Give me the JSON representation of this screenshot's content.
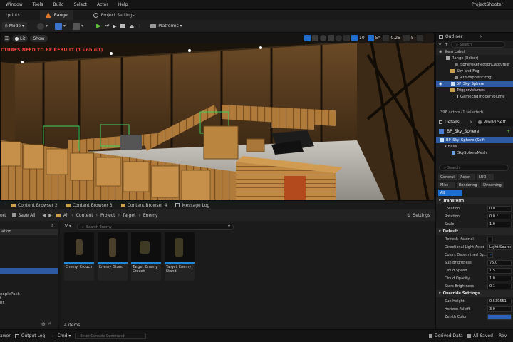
{
  "menu": {
    "items": [
      "Window",
      "Tools",
      "Build",
      "Select",
      "Actor",
      "Help"
    ],
    "project": "ProjectShooter"
  },
  "tabs": {
    "blueprints": "rprints",
    "range": "Range",
    "project_settings": "Project Settings"
  },
  "toolbar": {
    "mode": "n Mode",
    "platforms": "Platforms"
  },
  "viewport": {
    "lit": "Lit",
    "show": "Show",
    "grid_snap": "10",
    "angle_snap": "5°",
    "scale_snap": "0.25",
    "camera_speed": "5",
    "warning": "CTURES NEED TO BE REBUILT (1 unbuilt)"
  },
  "bottom_tabs": [
    "Content Browser 2",
    "Content Browser 3",
    "Content Browser 4",
    "Message Log"
  ],
  "content_browser": {
    "import_partial": "ort",
    "save_all": "Save All",
    "path": [
      "All",
      "Content",
      "Project",
      "Target",
      "Enemy"
    ],
    "settings": "Settings",
    "search_placeholder": "Search Enemy",
    "item_count": "4 items",
    "left_items": [
      "ation",
      "eoplePack",
      "t",
      "nt"
    ],
    "assets": [
      {
        "name": "Enemy_Crouch"
      },
      {
        "name": "Enemy_Stand"
      },
      {
        "name": "Target_Enemy_ Crouch"
      },
      {
        "name": "Target_Enemy_ Stand"
      }
    ]
  },
  "outliner": {
    "title": "Outliner",
    "search": "Search",
    "header": "Item Label",
    "rows": [
      {
        "label": "Range (Editor)",
        "indent": 1
      },
      {
        "label": "SphereReflectionCaptureTr",
        "indent": 3
      },
      {
        "label": "Sky and Fog",
        "indent": 2
      },
      {
        "label": "Atmospheric Fog",
        "indent": 3
      },
      {
        "label": "BP_Sky_Sphere",
        "indent": 3,
        "selected": true
      },
      {
        "label": "TriggerVolumes",
        "indent": 2
      },
      {
        "label": "GameEndTriggerVolume",
        "indent": 3
      }
    ],
    "status": "396 actors (1 selected)"
  },
  "details": {
    "tab": "Details",
    "world_settings_tab": "World Sett",
    "actor": "BP_Sky_Sphere",
    "components": [
      "BP_Sky_Sphere (Self)",
      "Base",
      "SkySphereMesh"
    ],
    "search": "Search",
    "filters_row1": [
      "General",
      "Actor",
      "LOD",
      "Misc"
    ],
    "filters_row2": [
      "Rendering",
      "Streaming",
      "All"
    ],
    "transform_title": "Transform",
    "transform": [
      {
        "name": "Location",
        "value": "0.0"
      },
      {
        "name": "Rotation",
        "value": "0.0 °"
      },
      {
        "name": "Scale",
        "value": "1.0"
      }
    ],
    "default_title": "Default",
    "defaults": [
      {
        "name": "Refresh Material",
        "value": ""
      },
      {
        "name": "Directional Light Actor",
        "value": "Light Source"
      },
      {
        "name": "Colors Determined By...",
        "value": "✓"
      },
      {
        "name": "Sun Brightness",
        "value": "75.0"
      },
      {
        "name": "Cloud Speed",
        "value": "1.5"
      },
      {
        "name": "Cloud Opacity",
        "value": "1.0"
      },
      {
        "name": "Stars Brightness",
        "value": "0.1"
      }
    ],
    "override_title": "Override Settings",
    "overrides": [
      {
        "name": "Sun Height",
        "value": "0.530551"
      },
      {
        "name": "Horizon Falloff",
        "value": "3.0"
      },
      {
        "name": "Zenith Color",
        "value": ""
      }
    ]
  },
  "statusbar": {
    "drawer": "awer",
    "output_log": "Output Log",
    "cmd": "Cmd",
    "console_placeholder": "Enter Console Command",
    "derived_data": "Derived Data",
    "all_saved": "All Saved",
    "revision": "Rev"
  },
  "colors": {
    "accent": "#1d6ed0",
    "selection": "#2d5aa3",
    "play_green": "#5bbf3a",
    "warning": "#ff4040"
  }
}
